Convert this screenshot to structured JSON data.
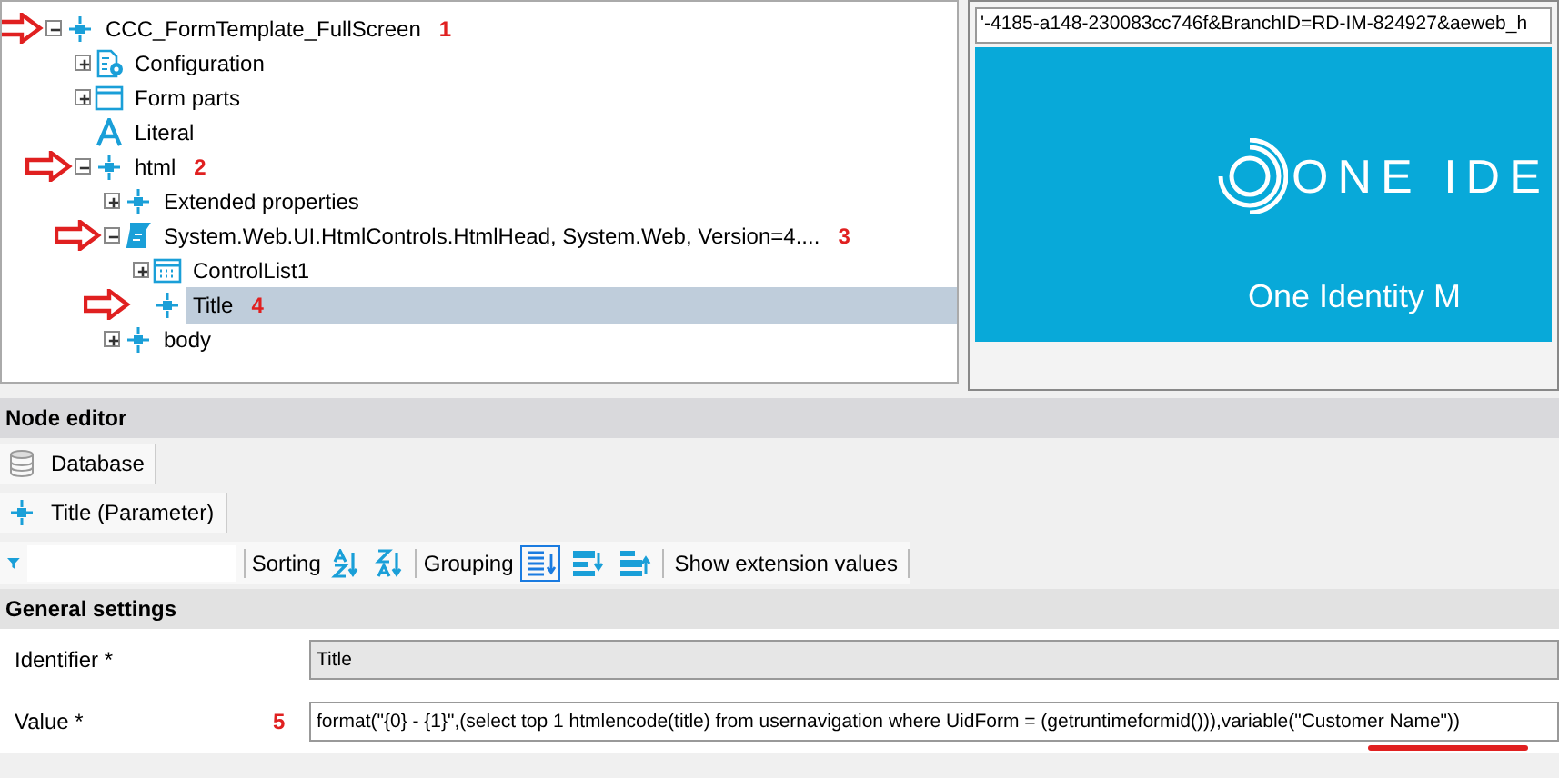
{
  "tree": [
    {
      "label": "CCC_FormTemplate_FullScreen",
      "kind": "element",
      "expanded": true,
      "selected": false,
      "marker": "1",
      "children": [
        {
          "label": "Configuration",
          "kind": "configuration",
          "expanded": false,
          "selected": false
        },
        {
          "label": "Form parts",
          "kind": "container",
          "expanded": false,
          "selected": false
        },
        {
          "label": "Literal",
          "kind": "literal",
          "selected": false
        },
        {
          "label": "html",
          "kind": "element",
          "expanded": true,
          "selected": false,
          "marker": "2",
          "children": [
            {
              "label": "Extended properties",
              "kind": "element",
              "expanded": false,
              "selected": false
            },
            {
              "label": "System.Web.UI.HtmlControls.HtmlHead, System.Web, Version=4....",
              "kind": "control",
              "expanded": true,
              "selected": false,
              "marker": "3",
              "children": [
                {
                  "label": "ControlList1",
                  "kind": "list",
                  "expanded": false,
                  "selected": false
                },
                {
                  "label": "Title",
                  "kind": "element",
                  "selected": true,
                  "marker": "4"
                }
              ]
            },
            {
              "label": "body",
              "kind": "element",
              "expanded": false,
              "selected": false
            }
          ]
        }
      ]
    }
  ],
  "preview": {
    "url": "'-4185-a148-230083cc746f&BranchID=RD-IM-824927&aeweb_h",
    "logo": "ONE IDE",
    "subtitle": "One Identity M"
  },
  "node_editor": {
    "title": "Node editor",
    "tabs": [
      {
        "label": "Database",
        "kind": "database"
      },
      {
        "label": "Title (Parameter)",
        "kind": "element"
      }
    ],
    "toolbar": {
      "sorting": "Sorting",
      "grouping": "Grouping",
      "extension": "Show extension values"
    },
    "section": "General settings",
    "fields": [
      {
        "label": "Identifier *",
        "value": "Title",
        "disabled": true
      },
      {
        "label": "Value *",
        "value": "format(\"{0} - {1}\",(select top 1 htmlencode(title) from usernavigation where UidForm = (getruntimeformid())),variable(\"Customer Name\"))",
        "disabled": false,
        "marker": "5"
      }
    ]
  }
}
